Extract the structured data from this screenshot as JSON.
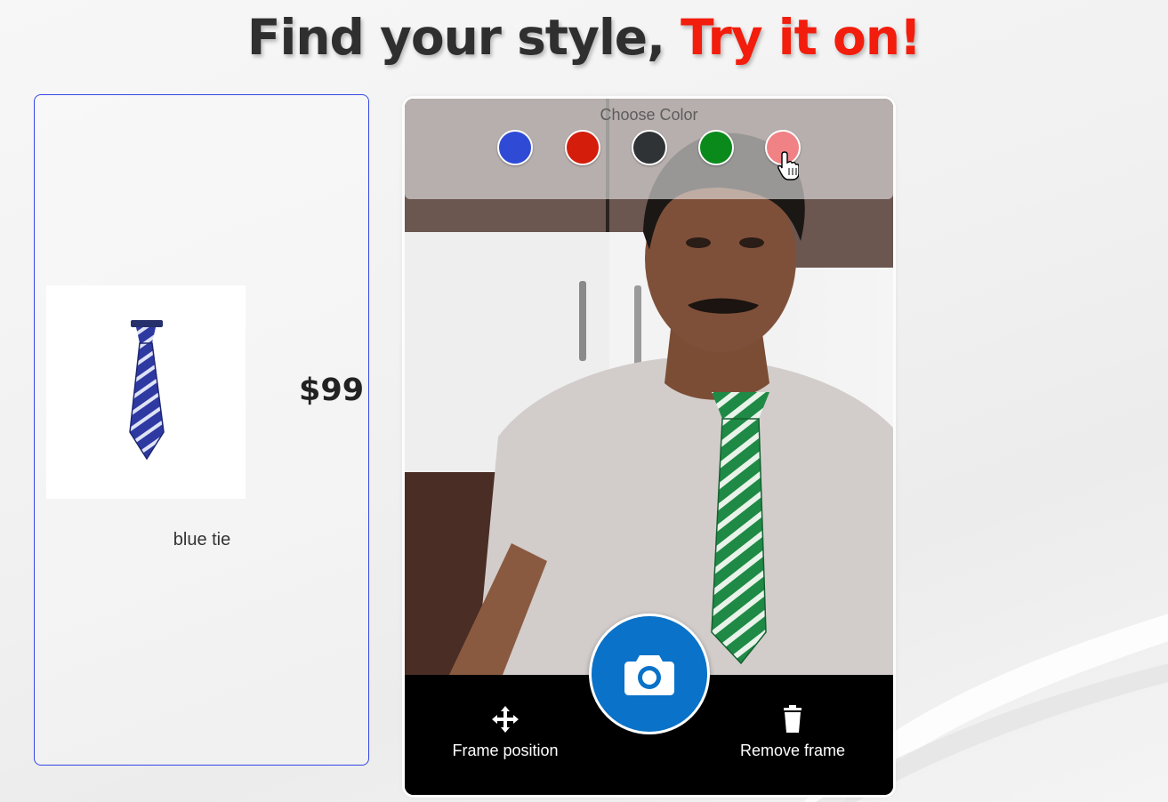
{
  "header": {
    "title_main": "Find your style,",
    "title_accent": "Try it on!"
  },
  "product": {
    "name": "blue tie",
    "price": "$99",
    "image_icon": "blue-striped-tie-image"
  },
  "try_on": {
    "color_picker": {
      "label": "Choose Color",
      "swatches": [
        {
          "name": "blue",
          "color": "#2f4bd6"
        },
        {
          "name": "red",
          "color": "#d41d0b"
        },
        {
          "name": "dark-gray",
          "color": "#2f3335"
        },
        {
          "name": "green",
          "color": "#0b8a1c"
        },
        {
          "name": "pink",
          "color": "#f08185"
        }
      ]
    },
    "controls": {
      "frame_position_label": "Frame position",
      "frame_position_icon": "move-arrows-icon",
      "remove_frame_label": "Remove frame",
      "remove_frame_icon": "trash-icon",
      "capture_icon": "camera-icon"
    }
  },
  "colors": {
    "accent_red": "#f21d0c",
    "card_border": "#3446e6",
    "capture_button": "#0a72c8"
  }
}
